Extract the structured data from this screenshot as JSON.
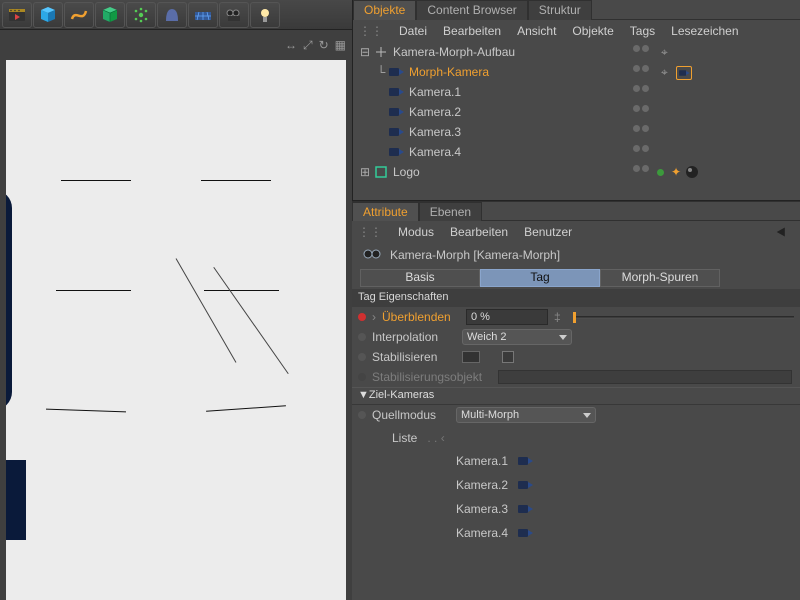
{
  "toolbar_icons": [
    "movie",
    "cube",
    "torus",
    "deformer",
    "particles",
    "landscape",
    "grid",
    "camera",
    "light"
  ],
  "viewport_tools": [
    "↔",
    "⤢",
    "↻",
    "▦"
  ],
  "object_panel": {
    "tabs": [
      "Objekte",
      "Content Browser",
      "Struktur"
    ],
    "menu": [
      "Datei",
      "Bearbeiten",
      "Ansicht",
      "Objekte",
      "Tags",
      "Lesezeichen"
    ],
    "tree": [
      {
        "indent": 0,
        "twist": "⊟",
        "icon": "null",
        "label": "Kamera-Morph-Aufbau",
        "sel": false,
        "tag": true
      },
      {
        "indent": 1,
        "twist": "└",
        "icon": "cam",
        "label": "Morph-Kamera",
        "sel": true,
        "tag": true,
        "tagbox": true
      },
      {
        "indent": 1,
        "twist": "",
        "icon": "cam",
        "label": "Kamera.1",
        "sel": false,
        "tag": false
      },
      {
        "indent": 1,
        "twist": "",
        "icon": "cam",
        "label": "Kamera.2",
        "sel": false,
        "tag": false
      },
      {
        "indent": 1,
        "twist": "",
        "icon": "cam",
        "label": "Kamera.3",
        "sel": false,
        "tag": false
      },
      {
        "indent": 1,
        "twist": "",
        "icon": "cam",
        "label": "Kamera.4",
        "sel": false,
        "tag": false
      },
      {
        "indent": 0,
        "twist": "⊞",
        "icon": "null-g",
        "label": "Logo",
        "sel": false,
        "tag": false,
        "extra": true
      }
    ]
  },
  "attribute_panel": {
    "tabs": [
      "Attribute",
      "Ebenen"
    ],
    "menu": [
      "Modus",
      "Bearbeiten",
      "Benutzer"
    ],
    "title": "Kamera-Morph [Kamera-Morph]",
    "segs": [
      "Basis",
      "Tag",
      "Morph-Spuren"
    ],
    "seg_active": 1,
    "section": "Tag Eigenschaften",
    "props": {
      "blend_label": "Überblenden",
      "blend_value": "0 %",
      "interp_label": "Interpolation",
      "interp_value": "Weich 2",
      "stab_label": "Stabilisieren",
      "stabobj_label": "Stabilisierungsobjekt"
    },
    "group": "▼Ziel-Kameras",
    "quellmodus_label": "Quellmodus",
    "quellmodus_value": "Multi-Morph",
    "list_label": "Liste",
    "list": [
      "Kamera.1",
      "Kamera.2",
      "Kamera.3",
      "Kamera.4"
    ]
  }
}
